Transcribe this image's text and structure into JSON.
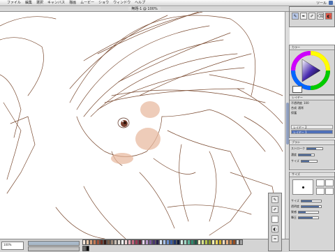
{
  "menubar": {
    "apple": "",
    "items": [
      "ファイル",
      "編集",
      "選択",
      "キャンバス",
      "描画",
      "ムービー",
      "ショウ",
      "ウィンドウ",
      "ヘルプ"
    ],
    "right_label": "ツール"
  },
  "window": {
    "title": "無題-1 @ 100%"
  },
  "bottom": {
    "zoom": "100%",
    "status": ""
  },
  "palette": {
    "swatches": [
      "#f7e9dd",
      "#e9c7a9",
      "#d8a07a",
      "#c47a56",
      "#a0523a",
      "#6d2f22",
      "#3a1a14",
      "#7a5c48",
      "#9c8878",
      "#c7bcb0",
      "#e3ddd6",
      "#ffffff",
      "#f2d7d9",
      "#e2a8b4",
      "#c76b82",
      "#9c3a57",
      "#5e1f35",
      "#e6d2ec",
      "#b899c9",
      "#7b5a9c",
      "#4a3570",
      "#2a2050",
      "#d8e4f4",
      "#a6c0e8",
      "#6b8fd0",
      "#3b5ea8",
      "#1f3670",
      "#0f1a3c",
      "#d6efe8",
      "#9fd8c4",
      "#5eb49a",
      "#2e8a6c",
      "#1a5a44",
      "#eff3c8",
      "#d8e28a",
      "#b6c64a",
      "#86962a",
      "#f7f0b0",
      "#ecd860",
      "#d4b22a",
      "#f4dcc0",
      "#e8b080",
      "#cc8044",
      "#944c22",
      "#d2d2d2",
      "#a0a0a0",
      "#6a6a6a",
      "#000000"
    ]
  },
  "tools_panel": {
    "buttons": [
      {
        "label": "✎",
        "name": "pencil-tool-icon"
      },
      {
        "label": "✒",
        "name": "pen-tool-icon"
      },
      {
        "label": "✐",
        "name": "brush-tool-icon"
      },
      {
        "label": "⌫",
        "name": "eraser-tool-icon"
      },
      {
        "label": "◐",
        "name": "fill-tool-icon"
      }
    ]
  },
  "color_panel": {
    "title": "カラー"
  },
  "layers_panel": {
    "title": "レイヤー",
    "rows": [
      {
        "label": "不透明度",
        "value": "100"
      },
      {
        "label": "合成",
        "value": "通常"
      },
      {
        "label": "保護",
        "value": ""
      }
    ],
    "layers": [
      {
        "name": "レイヤー 2",
        "selected": false
      },
      {
        "name": "レイヤー 1",
        "selected": true
      }
    ]
  },
  "brush_panel": {
    "title": "ブラシ",
    "rows": [
      {
        "label": "ストローク",
        "value": "ブラシ",
        "pct": 0.6
      },
      {
        "label": "濃度",
        "value": "",
        "pct": 0.8
      },
      {
        "label": "サイズ",
        "value": "",
        "pct": 0.5
      }
    ]
  },
  "size_panel": {
    "title": "サイズ",
    "rows": [
      {
        "label": "サイズ",
        "pct": 0.55
      },
      {
        "label": "透明度",
        "pct": 0.9
      },
      {
        "label": "質感",
        "pct": 0.35
      },
      {
        "label": "筆圧",
        "pct": 0.7
      }
    ]
  }
}
